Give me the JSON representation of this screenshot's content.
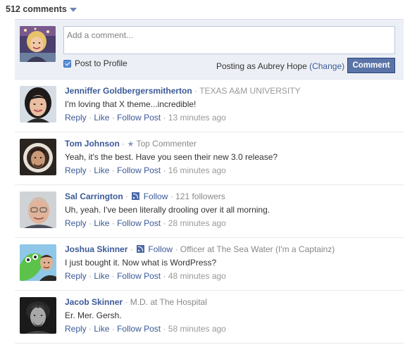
{
  "header": {
    "comment_count": "512 comments"
  },
  "composer": {
    "placeholder": "Add a comment...",
    "post_to_profile": "Post to Profile",
    "posting_as": "Posting as Aubrey Hope",
    "change": "(Change)",
    "comment_button": "Comment"
  },
  "actions": {
    "reply": "Reply",
    "like": "Like",
    "follow_post": "Follow Post",
    "sep": "·"
  },
  "comments": [
    {
      "author": "Jenniffer Goldbergersmitherton",
      "meta": "TEXAS A&M UNIVERSITY",
      "text": "I'm loving that X theme...incredible!",
      "time": "13 minutes ago"
    },
    {
      "author": "Tom Johnson",
      "badge": "Top Commenter",
      "text": "Yeah, it's the best. Have you seen their new 3.0 release?",
      "time": "16 minutes ago"
    },
    {
      "author": "Sal Carrington",
      "follow": "Follow",
      "followers": "121 followers",
      "text": "Uh, yeah. I've been literally drooling over it all morning.",
      "time": "28 minutes ago"
    },
    {
      "author": "Joshua Skinner",
      "follow": "Follow",
      "role": "Officer at",
      "org": "The Sea Water (I'm a Captainz)",
      "text": "I just bought it. Now what is WordPress?",
      "time": "48 minutes ago"
    },
    {
      "author": "Jacob Skinner",
      "role": "M.D. at",
      "org": "The Hospital",
      "text": "Er. Mer. Gersh.",
      "time": "58 minutes ago"
    }
  ]
}
